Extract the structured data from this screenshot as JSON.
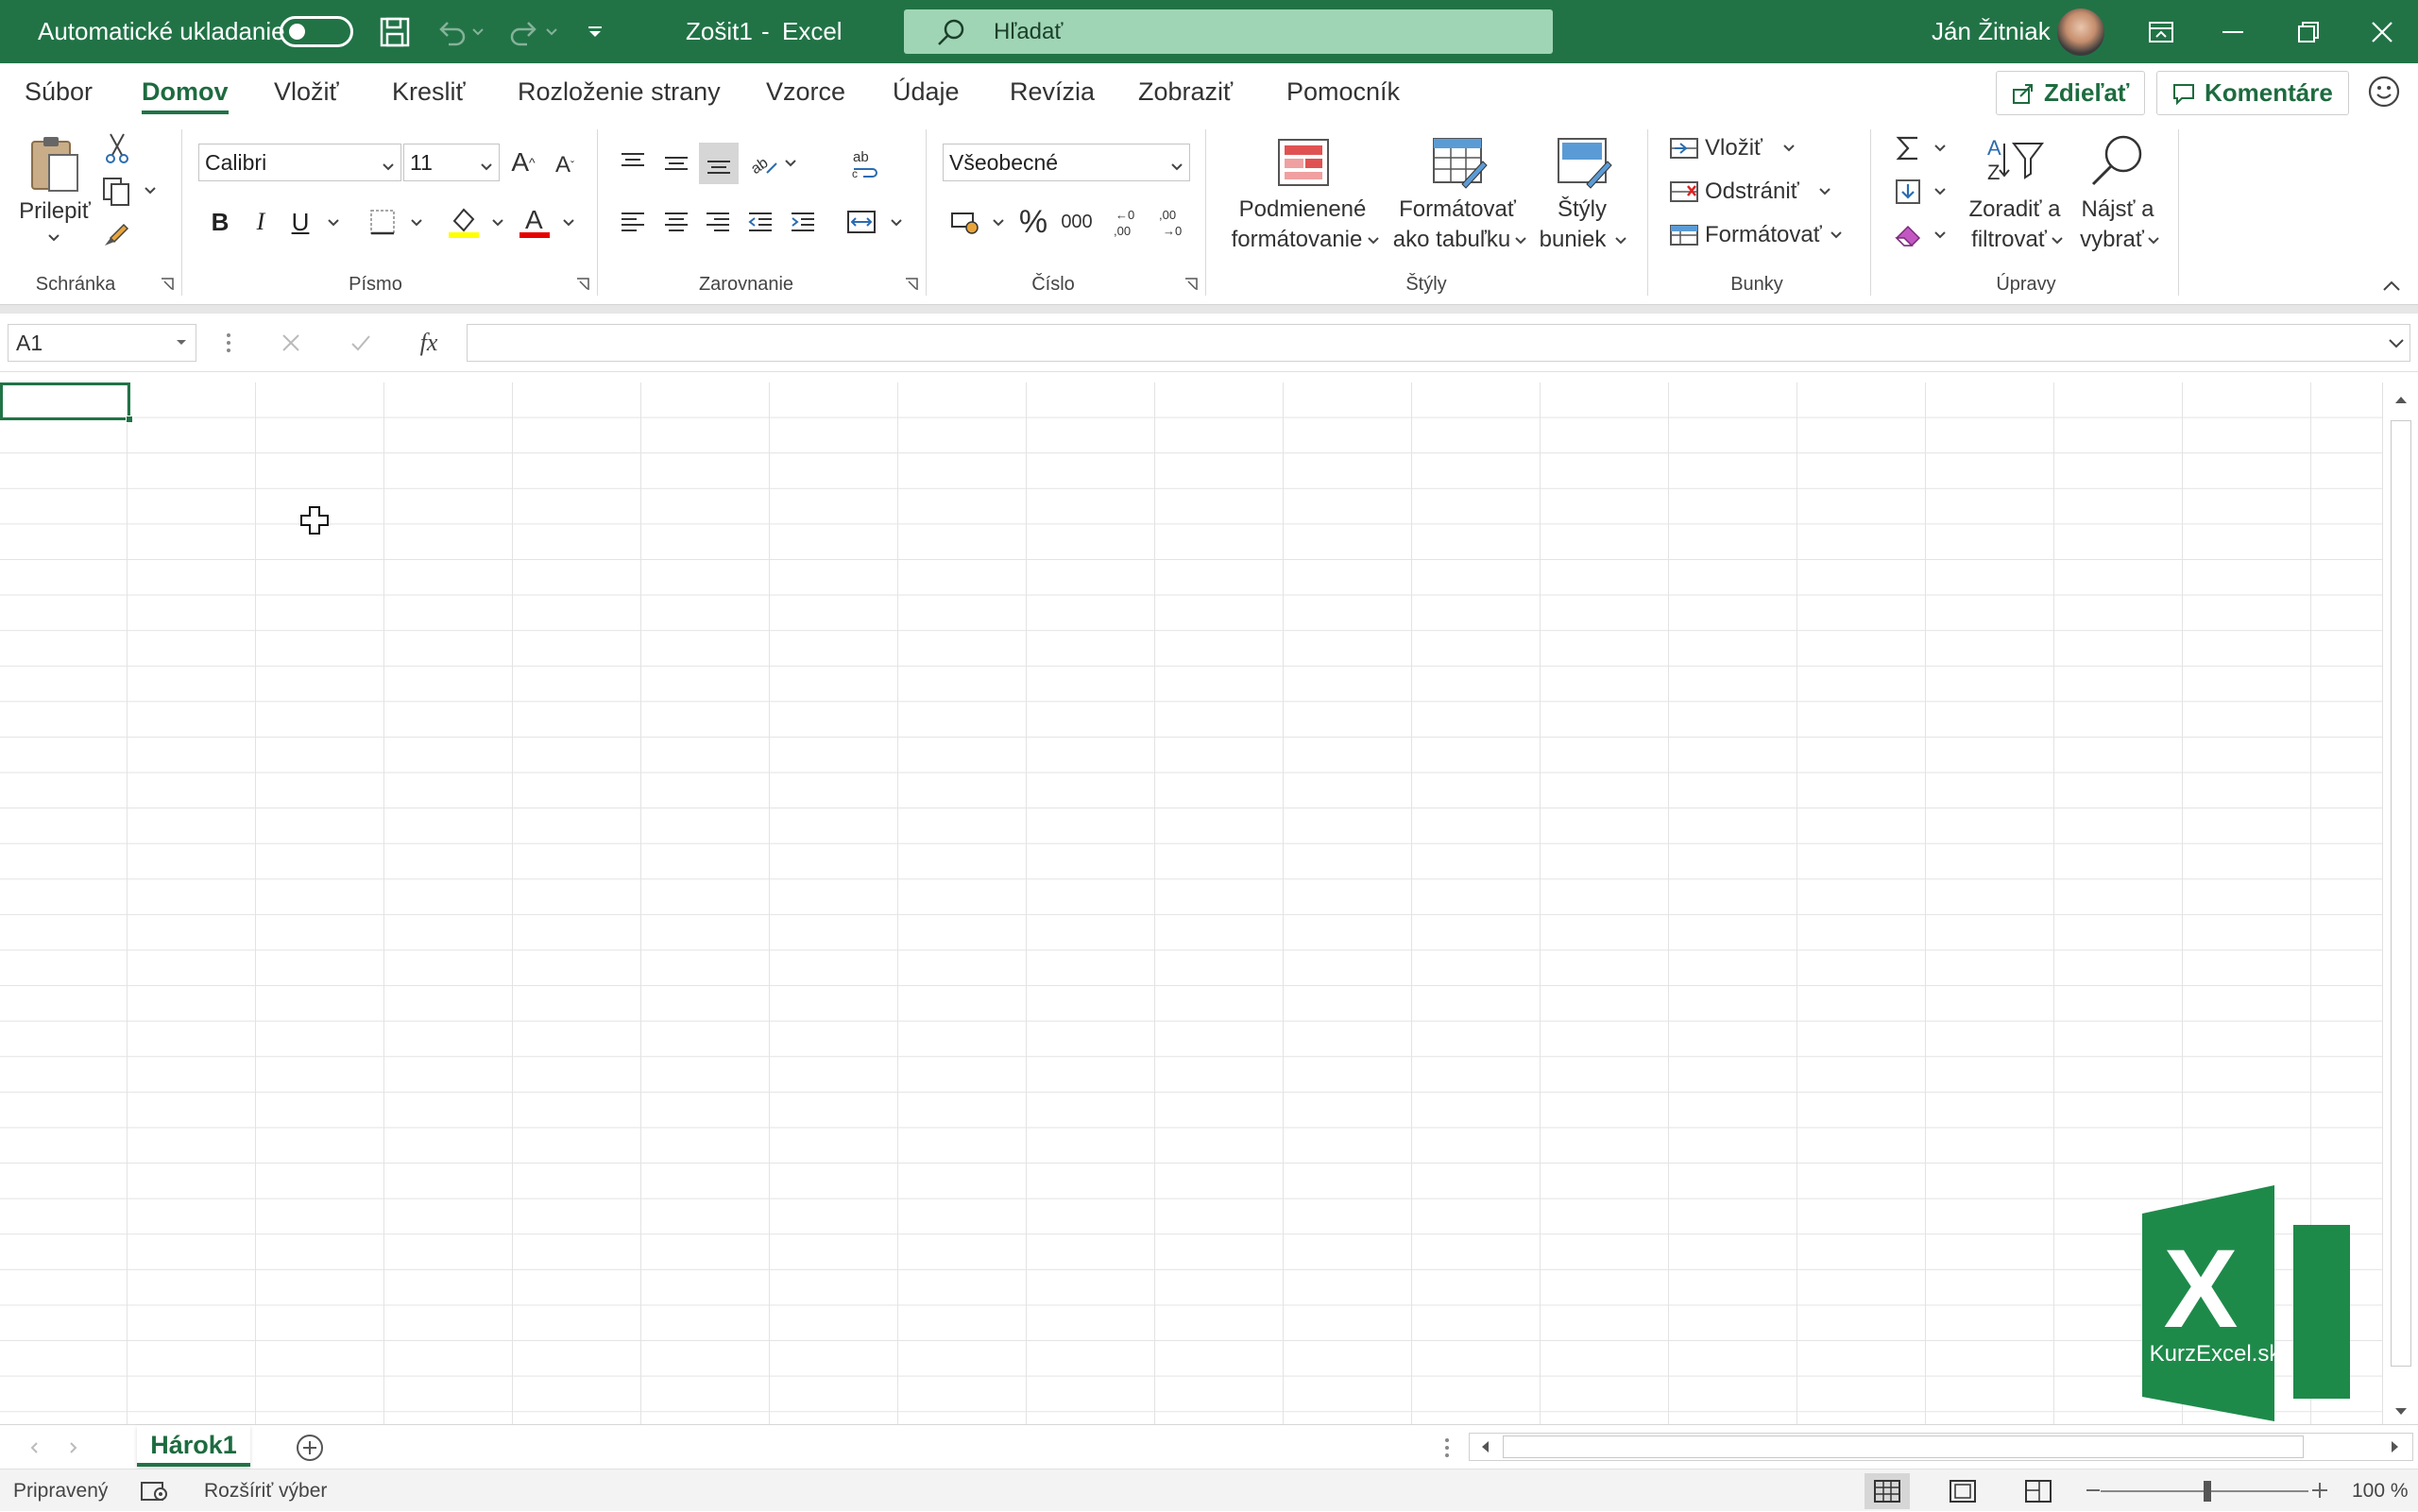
{
  "titlebar": {
    "autosave_label": "Automatické ukladanie",
    "doc_title": "Zošit1",
    "separator": "-",
    "app_name": "Excel",
    "search_placeholder": "Hľadať",
    "user_name": "Ján Žitniak"
  },
  "tabs": [
    "Súbor",
    "Domov",
    "Vložiť",
    "Kresliť",
    "Rozloženie strany",
    "Vzorce",
    "Údaje",
    "Revízia",
    "Zobraziť",
    "Pomocník"
  ],
  "active_tab": "Domov",
  "share_label": "Zdieľať",
  "comments_label": "Komentáre",
  "ribbon": {
    "clipboard": {
      "paste_label": "Prilepiť",
      "group": "Schránka"
    },
    "font": {
      "font_name": "Calibri",
      "font_size": "11",
      "bold": "B",
      "italic": "I",
      "underline": "U",
      "group": "Písmo"
    },
    "alignment": {
      "group": "Zarovnanie"
    },
    "number": {
      "format": "Všeobecné",
      "group": "Číslo",
      "percent": "%",
      "thousands": "000"
    },
    "styles": {
      "conditional_line1": "Podmienené",
      "conditional_line2": "formátovanie",
      "format_table_line1": "Formátovať",
      "format_table_line2": "ako tabuľku",
      "cell_styles_line1": "Štýly",
      "cell_styles_line2": "buniek",
      "group": "Štýly"
    },
    "cells": {
      "insert": "Vložiť",
      "delete": "Odstrániť",
      "format": "Formátovať",
      "group": "Bunky"
    },
    "editing": {
      "sort_line1": "Zoradiť a",
      "sort_line2": "filtrovať",
      "find_line1": "Nájsť a",
      "find_line2": "vybrať",
      "group": "Úpravy"
    }
  },
  "formula_bar": {
    "name_box": "A1",
    "fx": "fx",
    "value": ""
  },
  "sheets": [
    "Hárok1"
  ],
  "status": {
    "ready": "Pripravený",
    "extend": "Rozšíriť výber",
    "zoom": "100 %"
  },
  "logo": {
    "letter": "X",
    "caption": "KurzExcel.sk"
  },
  "colors": {
    "brand": "#217346",
    "title_bar": "#217346",
    "search_bg": "#9fd5b4"
  }
}
